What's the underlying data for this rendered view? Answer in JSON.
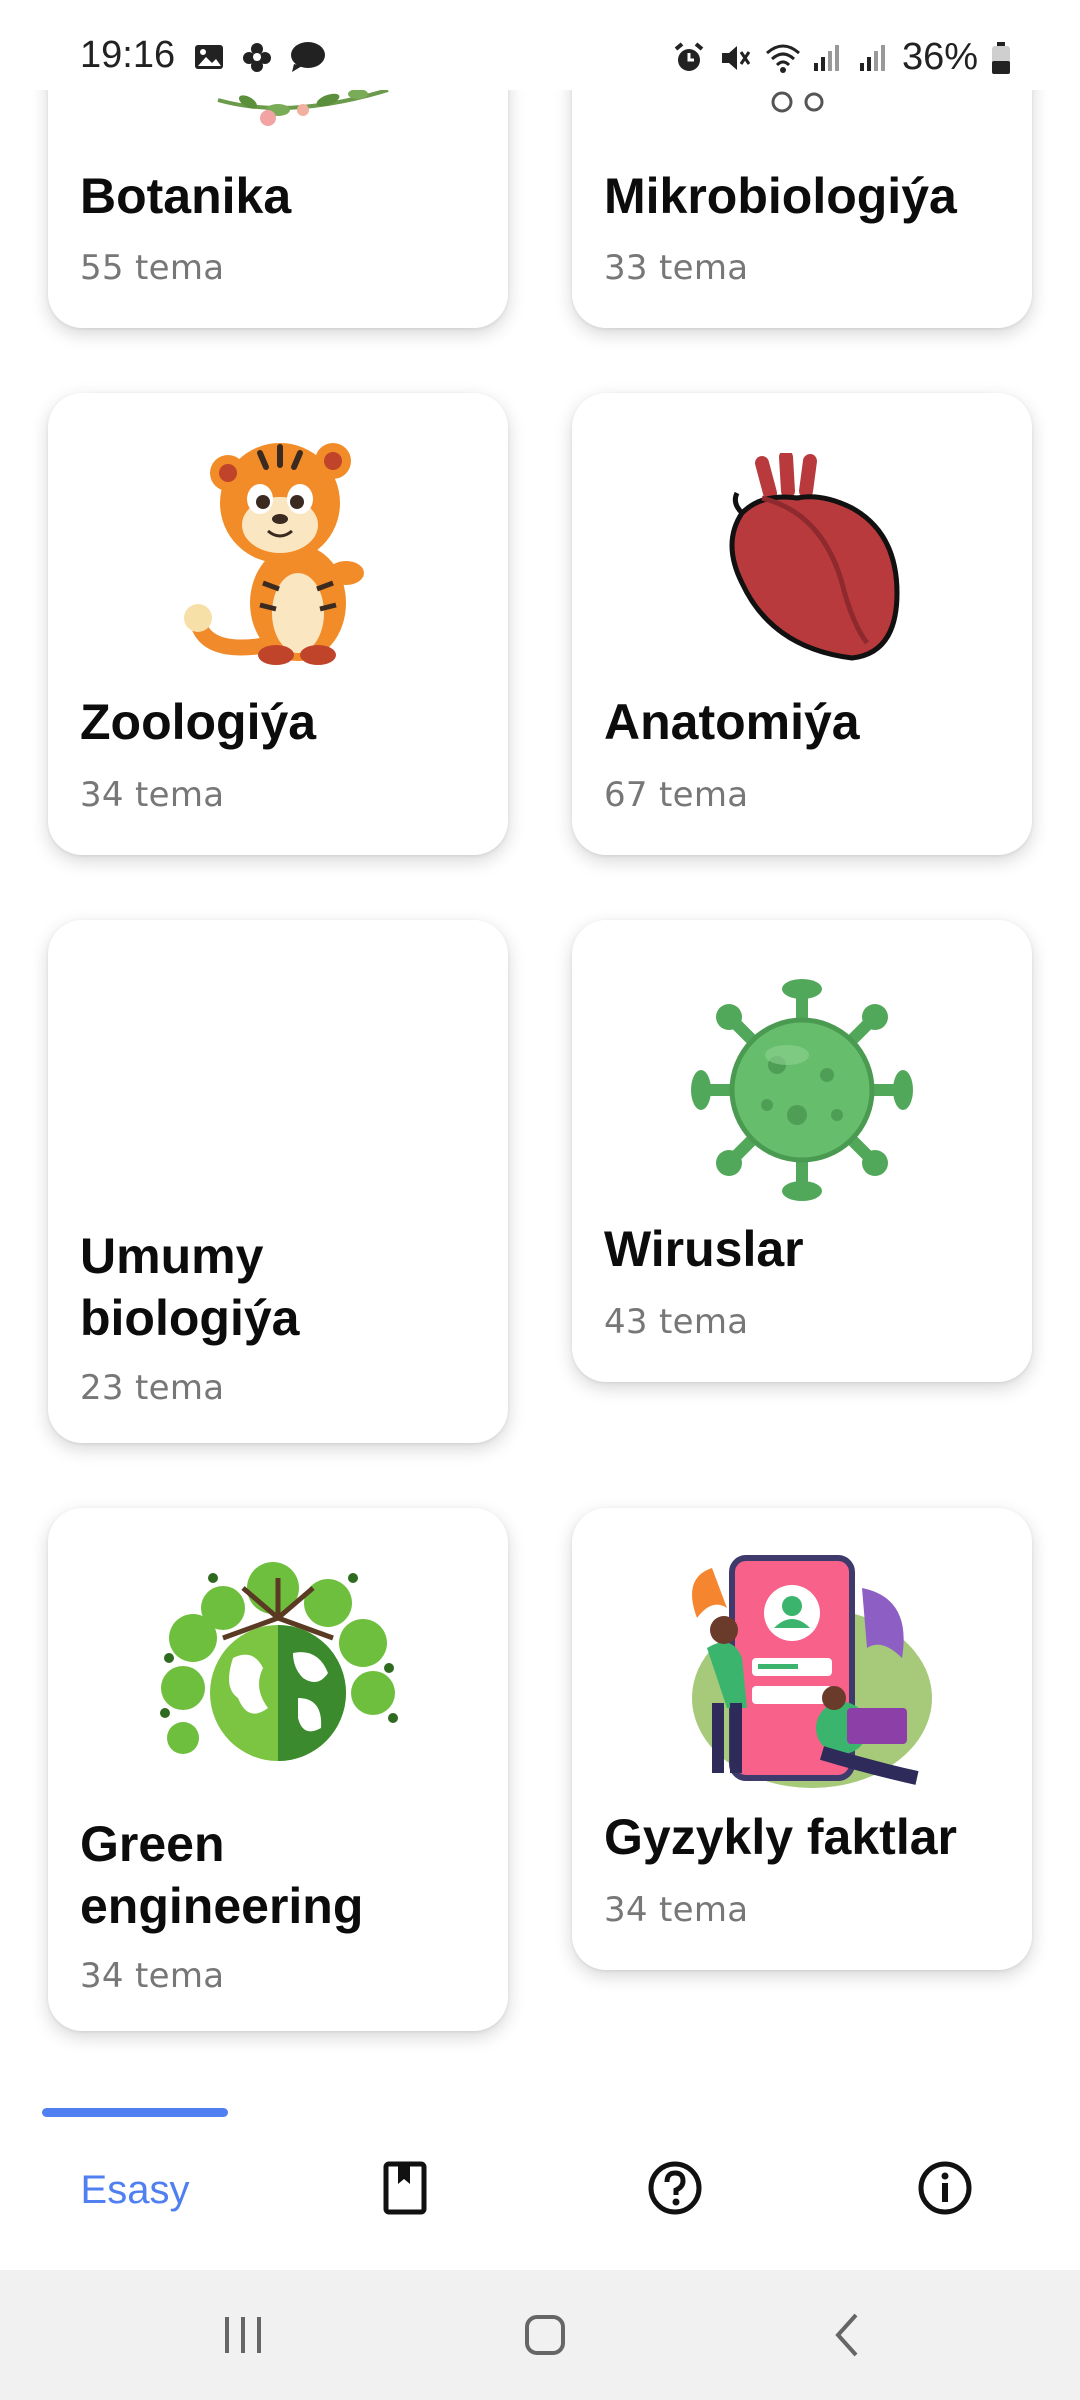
{
  "status_bar": {
    "time": "19:16",
    "battery": "36%"
  },
  "cards": [
    {
      "title": "Botanika",
      "subtitle": "55 tema",
      "icon": "flower-branch-icon"
    },
    {
      "title": "Mikrobiologiýa",
      "subtitle": "33 tema",
      "icon": "bubbles-icon"
    },
    {
      "title": "Zoologiýa",
      "subtitle": "34 tema",
      "icon": "tiger-icon"
    },
    {
      "title": "Anatomiýa",
      "subtitle": "67 tema",
      "icon": "heart-organ-icon"
    },
    {
      "title": "Umumy biologiýa",
      "subtitle": "23 tema",
      "icon": ""
    },
    {
      "title": "Wiruslar",
      "subtitle": "43 tema",
      "icon": "virus-icon"
    },
    {
      "title": "Green engineering",
      "subtitle": "34 tema",
      "icon": "green-earth-icon"
    },
    {
      "title": "Gyzykly faktlar",
      "subtitle": "34 tema",
      "icon": "people-phone-icon"
    }
  ],
  "bottom_nav": {
    "active_label": "Esasy",
    "items": [
      "home",
      "bookmark-icon",
      "help-icon",
      "info-icon"
    ]
  },
  "colors": {
    "accent": "#4f7ff0",
    "card_bg": "#ffffff",
    "subtitle": "#777777"
  }
}
